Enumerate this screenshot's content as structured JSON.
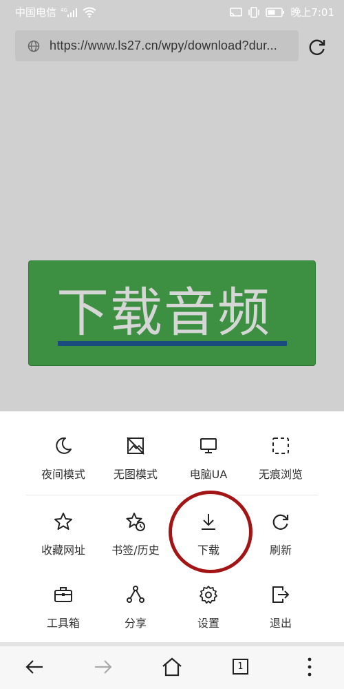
{
  "status_bar": {
    "carrier": "中国电信",
    "network": "4G",
    "time": "晚上7:01"
  },
  "address_bar": {
    "url": "https://www.ls27.cn/wpy/download?dur...",
    "globe_icon": "globe-icon",
    "reload_icon": "reload-icon"
  },
  "page": {
    "download_button_label": "下载音频",
    "download_button_color": "#3d8f41"
  },
  "menu": {
    "rows": [
      [
        {
          "label": "夜间模式",
          "icon": "moon-icon"
        },
        {
          "label": "无图模式",
          "icon": "no-image-icon"
        },
        {
          "label": "电脑UA",
          "icon": "monitor-icon"
        },
        {
          "label": "无痕浏览",
          "icon": "incognito-icon"
        }
      ],
      [
        {
          "label": "收藏网址",
          "icon": "star-icon"
        },
        {
          "label": "书签/历史",
          "icon": "bookmark-history-icon"
        },
        {
          "label": "下载",
          "icon": "download-icon"
        },
        {
          "label": "刷新",
          "icon": "refresh-icon"
        }
      ],
      [
        {
          "label": "工具箱",
          "icon": "toolbox-icon"
        },
        {
          "label": "分享",
          "icon": "share-icon"
        },
        {
          "label": "设置",
          "icon": "settings-icon"
        },
        {
          "label": "退出",
          "icon": "exit-icon"
        }
      ]
    ],
    "highlight_color": "#a31515"
  },
  "bottom_nav": {
    "tab_count": "1",
    "icons": [
      "back-arrow-icon",
      "forward-arrow-icon",
      "home-icon",
      "tabs-icon",
      "more-icon"
    ]
  }
}
